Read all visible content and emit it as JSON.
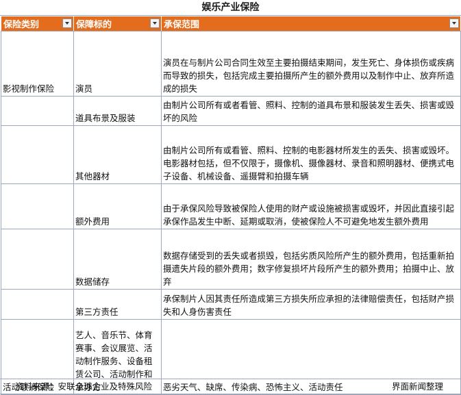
{
  "title": "娱乐产业保险",
  "headers": {
    "category": "保险类别",
    "object": "保障标的",
    "scope": "承保范围"
  },
  "rows": [
    {
      "category": "影视制作保险",
      "object": "演员",
      "scope": "演员在与制片公司合同生效至主要拍摄结束期间，发生死亡、身体损伤或疾病而导致的损失，包括完成主要拍摄所产生的额外费用以及制作中止、放弃所造成的损失"
    },
    {
      "category": "",
      "object": "道具布景及服装",
      "scope": "由制片公司所有或者看管、照料、控制的道具布景和服装发生丢失、损害或毁坏的风险"
    },
    {
      "category": "",
      "object": "其他器材",
      "scope": "由制片公司所有或看管、照料、控制的电影器材所发生的丢失、损害或毁坏。电影器材包括，但不仅限于，摄像机、摄像器材、录音和照明器材、便携式电子设备、机械设备、遥摄臂和拍摄车辆"
    },
    {
      "category": "",
      "object": "额外费用",
      "scope": "由于承保风险导致被保险人使用的财产或设施被损害或毁坏，并因此直接引起承保作品发生中断、延期或取消，使被保险人不可避免地发生额外费用"
    },
    {
      "category": "",
      "object": "数据储存",
      "scope": "数据存储受到的丢失或者损毁，包括劣质风险所产生的额外费用，包括重新拍摄遗失片段的额外费用；数字修复损坏片段所产生的额外费用；拍摄中止、放弃"
    },
    {
      "category": "",
      "object": "第三方责任",
      "scope": "承保制片人因其责任所造成第三方损失所应承担的法律赔偿责任，包括财产损失和人身伤害责任"
    },
    {
      "category": "活动取消保险",
      "object": "艺人、音乐节、体育赛事、会议展览、活动制作服务、设备租赁公司、活动制作和承办方",
      "scope": "恶劣天气、缺席、传染病、恐怖主义、活动责任"
    }
  ],
  "footer": {
    "source": "资料来源：安联全球企业及特殊风险",
    "credit": "界面新闻整理"
  },
  "colors": {
    "header_bg": "#e46c1d",
    "header_text": "#ffffff",
    "grid": "#9aa7bd"
  }
}
